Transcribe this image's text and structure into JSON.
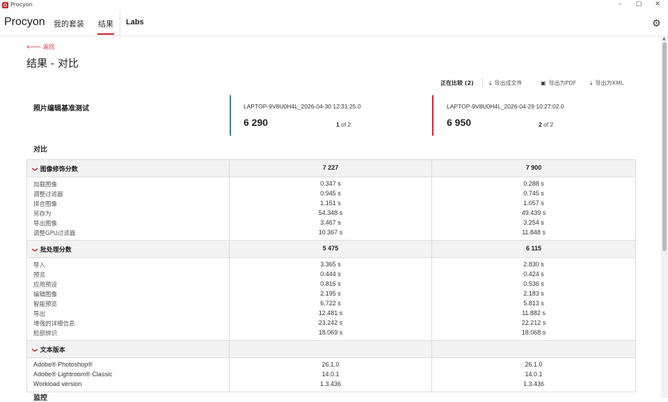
{
  "window": {
    "title": "Procyon",
    "controls": [
      "–",
      "▢",
      "✕"
    ]
  },
  "nav": {
    "brand": "Procyon",
    "tabs": [
      "我的套装",
      "结果",
      "Labs"
    ],
    "active_tab": "结果",
    "settings_icon": "gear-icon"
  },
  "header": {
    "back": "返回",
    "title": "结果 - 对比"
  },
  "actions": {
    "comparing": "正在比较 (2)",
    "export_file": "导出成文件",
    "export_pdf": "导出为PDF",
    "export_xml": "导出为XML"
  },
  "benchmark": {
    "name": "照片编辑基准测试",
    "runs": [
      {
        "name": "LAPTOP-9V8U0H4L_2026-04-30 12:31:25.0",
        "score": "6 290",
        "index": "1",
        "of": "of 2",
        "color": "#3a7f8f"
      },
      {
        "name": "LAPTOP-9V8U0H4L_2026-04-29 10:27:02.0",
        "score": "6 950",
        "index": "2",
        "of": "of 2",
        "color": "#c8202e"
      }
    ]
  },
  "compare_label": "对比",
  "sections": [
    {
      "title": "图像修饰分数",
      "values": [
        "7 227",
        "7 900"
      ],
      "rows": [
        {
          "label": "加载图像",
          "v1": "0.347 s",
          "v2": "0.288 s"
        },
        {
          "label": "调整过滤器",
          "v1": "0.945 s",
          "v2": "0.745 s"
        },
        {
          "label": "拼合图像",
          "v1": "1.151 s",
          "v2": "1.057 s"
        },
        {
          "label": "另存为",
          "v1": "54.348 s",
          "v2": "49.439 s"
        },
        {
          "label": "导出图像",
          "v1": "3.467 s",
          "v2": "3.254 s"
        },
        {
          "label": "调整GPU过滤器",
          "v1": "10.367 s",
          "v2": "11.848 s"
        }
      ]
    },
    {
      "title": "批处理分数",
      "values": [
        "5 475",
        "6 115"
      ],
      "rows": [
        {
          "label": "导入",
          "v1": "3.365 s",
          "v2": "2.830 s"
        },
        {
          "label": "预览",
          "v1": "0.444 s",
          "v2": "0.424 s"
        },
        {
          "label": "应用预设",
          "v1": "0.816 s",
          "v2": "0.536 s"
        },
        {
          "label": "编辑图像",
          "v1": "2.195 s",
          "v2": "2.183 s"
        },
        {
          "label": "智能预览",
          "v1": "6.722 s",
          "v2": "5.813 s"
        },
        {
          "label": "导出",
          "v1": "12.481 s",
          "v2": "11.882 s"
        },
        {
          "label": "增强的详细信息",
          "v1": "23.242 s",
          "v2": "22.212 s"
        },
        {
          "label": "脸部辨识",
          "v1": "18.069 s",
          "v2": "18.068 s"
        }
      ]
    },
    {
      "title": "文本版本",
      "values": [
        "",
        ""
      ],
      "rows": [
        {
          "label": "Adobe® Photoshop®",
          "v1": "26.1.0",
          "v2": "26.1.0",
          "en": true
        },
        {
          "label": "Adobe® Lightroom® Classic",
          "v1": "14.0.1",
          "v2": "14.0.1",
          "en": true
        },
        {
          "label": "Workload version",
          "v1": "1.3.436",
          "v2": "1.3.436",
          "en": true
        }
      ]
    }
  ],
  "footer_cut": "监控"
}
